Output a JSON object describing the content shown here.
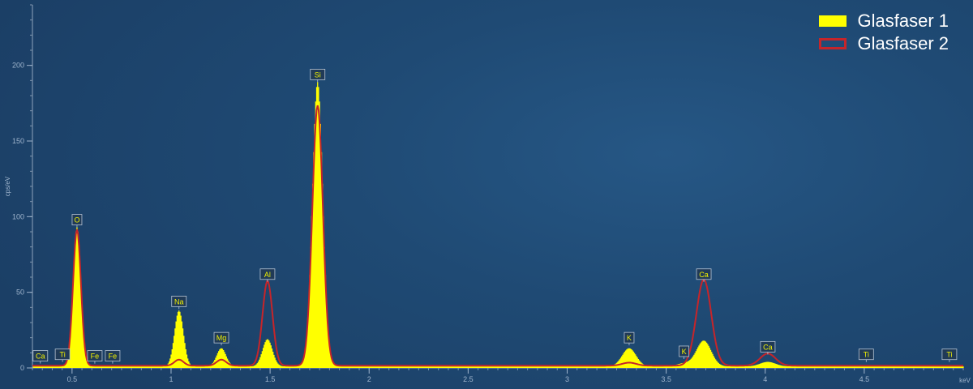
{
  "chart_data": {
    "type": "area",
    "title": "",
    "xlabel": "keV",
    "ylabel": "cps/eV",
    "xlim": [
      0.3,
      5.0
    ],
    "ylim": [
      0,
      240
    ],
    "x_ticks": [
      0.5,
      1,
      1.5,
      2,
      2.5,
      3,
      3.5,
      4,
      4.5
    ],
    "x_tick_labels": [
      "0.5",
      "1",
      "1.5",
      "2",
      "2.5",
      "3",
      "3.5",
      "4",
      "4.5"
    ],
    "y_ticks": [
      0,
      50,
      100,
      150,
      200
    ],
    "y_tick_labels": [
      "0",
      "50",
      "100",
      "150",
      "200"
    ],
    "grid": false,
    "legend_position": "top-right",
    "colors": {
      "series1": "#ffff00",
      "series2": "#c6252a",
      "label_text": "#f2f200"
    },
    "series": [
      {
        "name": "Glasfaser 1",
        "style": "filled",
        "peaks": [
          {
            "element": "O",
            "energy": 0.525,
            "height": 92
          },
          {
            "element": "Na",
            "energy": 1.04,
            "height": 37
          },
          {
            "element": "Mg",
            "energy": 1.254,
            "height": 12
          },
          {
            "element": "Al",
            "energy": 1.487,
            "height": 18
          },
          {
            "element": "Si",
            "energy": 1.74,
            "height": 188
          },
          {
            "element": "K",
            "energy": 3.313,
            "height": 12
          },
          {
            "element": "K",
            "energy": 3.59,
            "height": 2
          },
          {
            "element": "Ca",
            "energy": 3.69,
            "height": 17
          },
          {
            "element": "Ca",
            "energy": 4.013,
            "height": 3
          }
        ],
        "background": 1
      },
      {
        "name": "Glasfaser 2",
        "style": "outline",
        "peaks": [
          {
            "element": "O",
            "energy": 0.525,
            "height": 90
          },
          {
            "element": "Na",
            "energy": 1.04,
            "height": 4
          },
          {
            "element": "Mg",
            "energy": 1.254,
            "height": 4
          },
          {
            "element": "Al",
            "energy": 1.487,
            "height": 56
          },
          {
            "element": "Si",
            "energy": 1.74,
            "height": 172
          },
          {
            "element": "K",
            "energy": 3.313,
            "height": 2
          },
          {
            "element": "Ca",
            "energy": 3.69,
            "height": 57
          },
          {
            "element": "Ca",
            "energy": 4.013,
            "height": 8
          }
        ],
        "background": 1.5
      }
    ],
    "peak_labels": [
      {
        "text": "Ca",
        "energy": 0.34,
        "y": 8
      },
      {
        "text": "Ti",
        "energy": 0.452,
        "y": 9
      },
      {
        "text": "O",
        "energy": 0.525,
        "y": 98
      },
      {
        "text": "Fe",
        "energy": 0.615,
        "y": 8
      },
      {
        "text": "Fe",
        "energy": 0.705,
        "y": 8
      },
      {
        "text": "Na",
        "energy": 1.04,
        "y": 44
      },
      {
        "text": "Mg",
        "energy": 1.254,
        "y": 20
      },
      {
        "text": "Al",
        "energy": 1.487,
        "y": 62
      },
      {
        "text": "Si",
        "energy": 1.74,
        "y": 194
      },
      {
        "text": "K",
        "energy": 3.313,
        "y": 20
      },
      {
        "text": "K",
        "energy": 3.59,
        "y": 11
      },
      {
        "text": "Ca",
        "energy": 3.69,
        "y": 62
      },
      {
        "text": "Ca",
        "energy": 4.013,
        "y": 14
      },
      {
        "text": "Ti",
        "energy": 4.51,
        "y": 9
      },
      {
        "text": "Ti",
        "energy": 4.93,
        "y": 9
      }
    ]
  },
  "legend": {
    "items": [
      {
        "label": "Glasfaser 1",
        "icon": "filled-yellow-swatch"
      },
      {
        "label": "Glasfaser 2",
        "icon": "red-outline-swatch"
      }
    ]
  }
}
